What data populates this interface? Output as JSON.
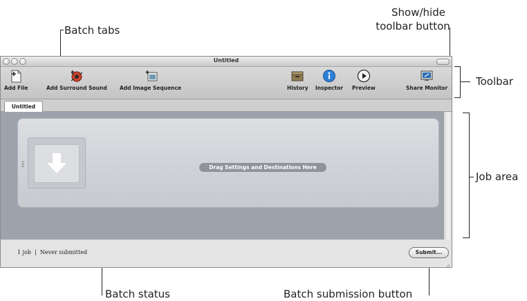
{
  "callouts": {
    "batch_tabs": "Batch tabs",
    "show_hide_line1": "Show/hide",
    "show_hide_line2": "toolbar button",
    "toolbar": "Toolbar",
    "job_area": "Job area",
    "batch_status": "Batch status",
    "batch_submission": "Batch submission button"
  },
  "window": {
    "title": "Untitled"
  },
  "toolbar": {
    "items": [
      {
        "label": "Add File",
        "icon": "add-file-icon"
      },
      {
        "label": "Add Surround Sound",
        "icon": "add-surround-sound-icon"
      },
      {
        "label": "Add Image Sequence",
        "icon": "add-image-sequence-icon"
      },
      {
        "label": "History",
        "icon": "history-icon"
      },
      {
        "label": "Inspector",
        "icon": "inspector-icon"
      },
      {
        "label": "Preview",
        "icon": "preview-icon"
      },
      {
        "label": "Share Monitor",
        "icon": "share-monitor-icon"
      }
    ]
  },
  "tabs": [
    {
      "label": "Untitled"
    }
  ],
  "job_area": {
    "drop_hint": "Drag Settings and Destinations Here"
  },
  "status": {
    "text": "1 job  |  Never submitted",
    "submit_label": "Submit..."
  },
  "colors": {
    "job_area_bg": "#9da3ad",
    "inspector_blue": "#2f7fd6",
    "surround_red": "#d0422e"
  }
}
